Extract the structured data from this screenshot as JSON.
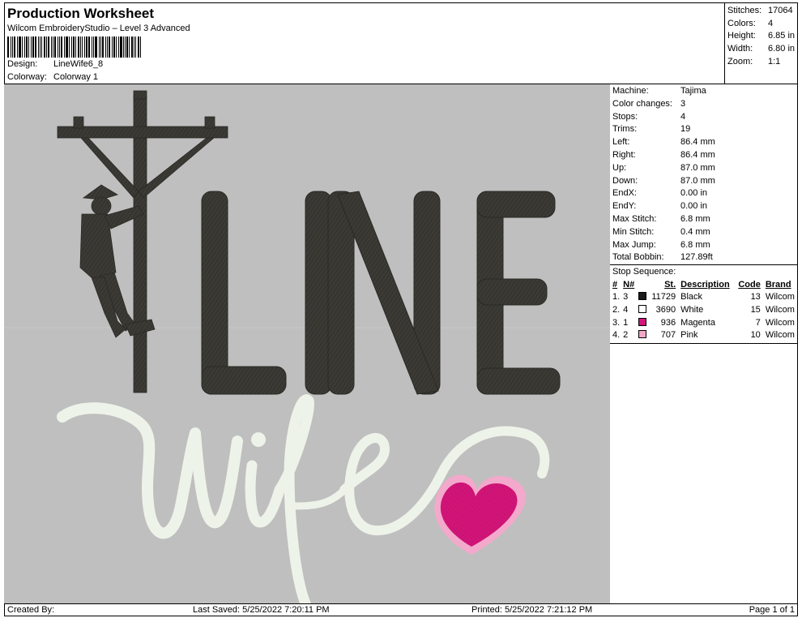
{
  "header": {
    "title": "Production Worksheet",
    "software": "Wilcom EmbroideryStudio – Level 3 Advanced",
    "design_label": "Design:",
    "design_value": "LineWife6_8",
    "colorway_label": "Colorway:",
    "colorway_value": "Colorway 1"
  },
  "stats": [
    {
      "label": "Stitches:",
      "value": "17064"
    },
    {
      "label": "Colors:",
      "value": "4"
    },
    {
      "label": "Height:",
      "value": "6.85 in"
    },
    {
      "label": "Width:",
      "value": "6.80 in"
    },
    {
      "label": "Zoom:",
      "value": "1:1"
    }
  ],
  "machine": [
    {
      "label": "Machine:",
      "value": "Tajima"
    },
    {
      "label": "Color changes:",
      "value": "3"
    },
    {
      "label": "Stops:",
      "value": "4"
    },
    {
      "label": "Trims:",
      "value": "19"
    },
    {
      "label": "Left:",
      "value": "86.4 mm"
    },
    {
      "label": "Right:",
      "value": "86.4 mm"
    },
    {
      "label": "Up:",
      "value": "87.0 mm"
    },
    {
      "label": "Down:",
      "value": "87.0 mm"
    },
    {
      "label": "EndX:",
      "value": "0.00 in"
    },
    {
      "label": "EndY:",
      "value": "0.00 in"
    },
    {
      "label": "Max Stitch:",
      "value": "6.8 mm"
    },
    {
      "label": "Min Stitch:",
      "value": "0.4 mm"
    },
    {
      "label": "Max Jump:",
      "value": "6.8 mm"
    },
    {
      "label": "Total Bobbin:",
      "value": "127.89ft"
    }
  ],
  "stop_sequence": {
    "title": "Stop Sequence:",
    "headers": {
      "num": "#",
      "needle": "N#",
      "stitches": "St.",
      "description": "Description",
      "code": "Code",
      "brand": "Brand"
    },
    "rows": [
      {
        "num": "1.",
        "needle": "3",
        "color": "#1a1a1a",
        "stitches": "11729",
        "description": "Black",
        "code": "13",
        "brand": "Wilcom"
      },
      {
        "num": "2.",
        "needle": "4",
        "color": "#ffffff",
        "stitches": "3690",
        "description": "White",
        "code": "15",
        "brand": "Wilcom"
      },
      {
        "num": "3.",
        "needle": "1",
        "color": "#d4157a",
        "stitches": "936",
        "description": "Magenta",
        "code": "7",
        "brand": "Wilcom"
      },
      {
        "num": "4.",
        "needle": "2",
        "color": "#f2a6c8",
        "stitches": "707",
        "description": "Pink",
        "code": "10",
        "brand": "Wilcom"
      }
    ]
  },
  "design_art": {
    "word_top": "LINE",
    "word_bottom": "wife",
    "preview_background": "#bfbfbf",
    "thread_black": "#3b3a35",
    "thread_white": "#eef3ea",
    "thread_magenta": "#d4157a",
    "thread_pink": "#f3a9cb"
  },
  "footer": {
    "created_by": "Created By:",
    "last_saved": "Last Saved: 5/25/2022 7:20:11 PM",
    "printed": "Printed: 5/25/2022 7:21:12 PM",
    "page": "Page 1 of 1"
  }
}
